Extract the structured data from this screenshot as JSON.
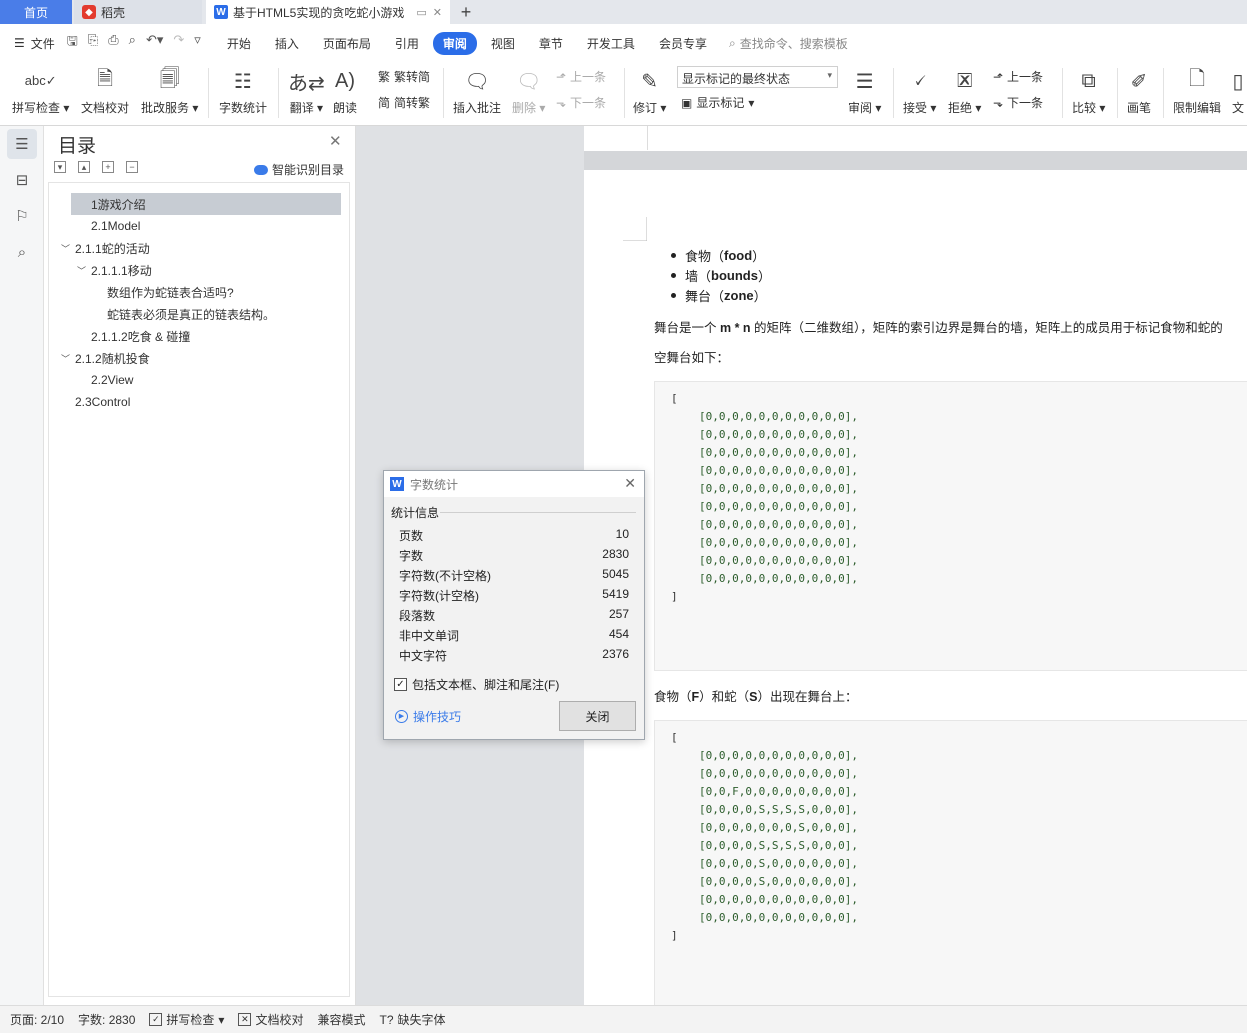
{
  "tabs": {
    "home": "首页",
    "daoke": "稻壳",
    "doc": "基于HTML5实现的贪吃蛇小游戏"
  },
  "menu": {
    "file": "文件",
    "tabs": [
      "开始",
      "插入",
      "页面布局",
      "引用",
      "审阅",
      "视图",
      "章节",
      "开发工具",
      "会员专享"
    ],
    "active": "审阅",
    "search": "查找命令、搜索模板"
  },
  "ribbon": {
    "spell": "拼写检查",
    "proof": "文档校对",
    "revise_service": "批改服务",
    "word_count": "字数统计",
    "translate": "翻译",
    "read": "朗读",
    "trad": "繁转简",
    "simp": "简转繁",
    "insert_comment": "插入批注",
    "delete": "删除",
    "prev": "上一条",
    "next": "下一条",
    "track": "修订",
    "markup_state": "显示标记的最终状态",
    "show_markup": "显示标记",
    "review": "审阅",
    "accept": "接受",
    "reject": "拒绝",
    "prev2": "上一条",
    "next2": "下一条",
    "compare": "比较",
    "pen": "画笔",
    "restrict": "限制编辑",
    "doc_cut": "文"
  },
  "toc": {
    "title": "目录",
    "smart": "智能识别目录",
    "items": [
      "1游戏介绍",
      "2.1Model",
      "2.1.1蛇的活动",
      "2.1.1.1移动",
      "数组作为蛇链表合适吗?",
      "蛇链表必须是真正的链表结构。",
      "2.1.1.2吃食 & 碰撞",
      "2.1.2随机投食",
      "2.2View",
      "2.3Control"
    ]
  },
  "doc": {
    "bullets": [
      {
        "pre": "食物（",
        "bold": "food",
        "post": "）"
      },
      {
        "pre": "墙（",
        "bold": "bounds",
        "post": "）"
      },
      {
        "pre": "舞台（",
        "bold": "zone",
        "post": "）"
      }
    ],
    "para1_pre": "舞台是一个 ",
    "para1_bold": "m * n",
    "para1_post": " 的矩阵（二维数组），矩阵的索引边界是舞台的墙，矩阵上的成员用于标记食物和蛇的",
    "para2": "空舞台如下：",
    "para3_a": "食物（",
    "para3_b": "F",
    "para3_c": "）和蛇（",
    "para3_d": "S",
    "para3_e": "）出现在舞台上：",
    "open": "[",
    "close": "]",
    "code1": [
      "[0,0,0,0,0,0,0,0,0,0,0],",
      "[0,0,0,0,0,0,0,0,0,0,0],",
      "[0,0,0,0,0,0,0,0,0,0,0],",
      "[0,0,0,0,0,0,0,0,0,0,0],",
      "[0,0,0,0,0,0,0,0,0,0,0],",
      "[0,0,0,0,0,0,0,0,0,0,0],",
      "[0,0,0,0,0,0,0,0,0,0,0],",
      "[0,0,0,0,0,0,0,0,0,0,0],",
      "[0,0,0,0,0,0,0,0,0,0,0],",
      "[0,0,0,0,0,0,0,0,0,0,0],"
    ],
    "code2": [
      "[0,0,0,0,0,0,0,0,0,0,0],",
      "[0,0,0,0,0,0,0,0,0,0,0],",
      "[0,0,F,0,0,0,0,0,0,0,0],",
      "[0,0,0,0,S,S,S,S,0,0,0],",
      "[0,0,0,0,0,0,0,S,0,0,0],",
      "[0,0,0,0,S,S,S,S,0,0,0],",
      "[0,0,0,0,S,0,0,0,0,0,0],",
      "[0,0,0,0,S,0,0,0,0,0,0],",
      "[0,0,0,0,0,0,0,0,0,0,0],",
      "[0,0,0,0,0,0,0,0,0,0,0],"
    ]
  },
  "dialog": {
    "title": "字数统计",
    "section": "统计信息",
    "rows": [
      {
        "label": "页数",
        "value": "10"
      },
      {
        "label": "字数",
        "value": "2830"
      },
      {
        "label": "字符数(不计空格)",
        "value": "5045"
      },
      {
        "label": "字符数(计空格)",
        "value": "5419"
      },
      {
        "label": "段落数",
        "value": "257"
      },
      {
        "label": "非中文单词",
        "value": "454"
      },
      {
        "label": "中文字符",
        "value": "2376"
      }
    ],
    "checkbox": "包括文本框、脚注和尾注(F)",
    "tips": "操作技巧",
    "close": "关闭"
  },
  "status": {
    "page": "页面: 2/10",
    "words": "字数: 2830",
    "spell": "拼写检查",
    "proof": "文档校对",
    "compat": "兼容模式",
    "missing_font": "缺失字体"
  },
  "colors": {
    "accent": "#2b6de8",
    "home_tab": "#4a7de8"
  }
}
